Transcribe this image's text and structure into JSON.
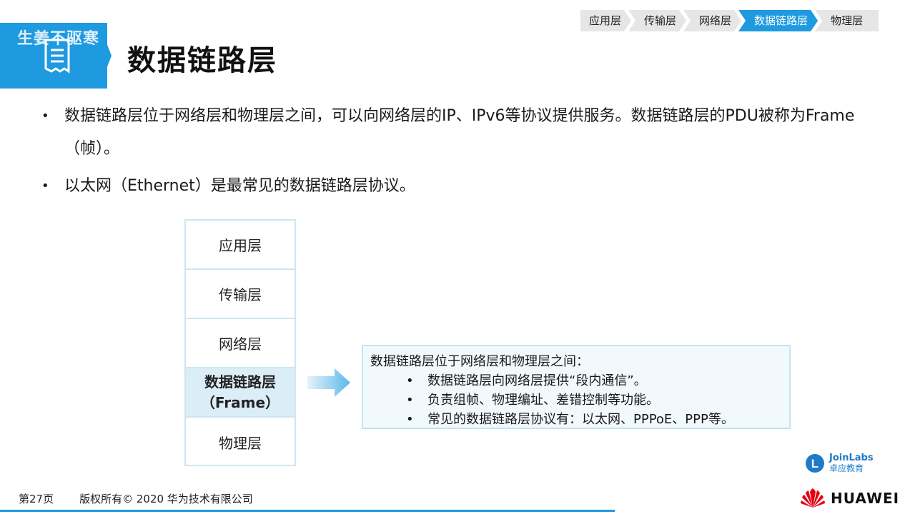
{
  "watermark": "生姜不驱寒",
  "title": "数据链路层",
  "breadcrumb": [
    "应用层",
    "传输层",
    "网络层",
    "数据链路层",
    "物理层"
  ],
  "breadcrumb_active": "数据链路层",
  "bullets": [
    "数据链路层位于网络层和物理层之间，可以向网络层的IP、IPv6等协议提供服务。数据链路层的PDU被称为Frame（帧）。",
    "以太网（Ethernet）是最常见的数据链路层协议。"
  ],
  "layers": {
    "application": "应用层",
    "transport": "传输层",
    "network": "网络层",
    "datalink": "数据链路层",
    "datalink_sub": "（Frame）",
    "physical": "物理层"
  },
  "info_box": {
    "heading": "数据链路层位于网络层和物理层之间：",
    "items": [
      "数据链路层向网络层提供“段内通信”。",
      "负责组帧、物理编址、差错控制等功能。",
      "常见的数据链路层协议有：以太网、PPPoE、PPP等。"
    ]
  },
  "footer": {
    "page": "第27页",
    "copyright": "版权所有© 2020 华为技术有限公司"
  },
  "logos": {
    "joinlabs_en": "JoinLabs",
    "joinlabs_cn": "卓应教育",
    "huawei": "HUAWEI"
  },
  "colors": {
    "accent": "#1e9ae0",
    "huawei_red": "#e60012"
  }
}
